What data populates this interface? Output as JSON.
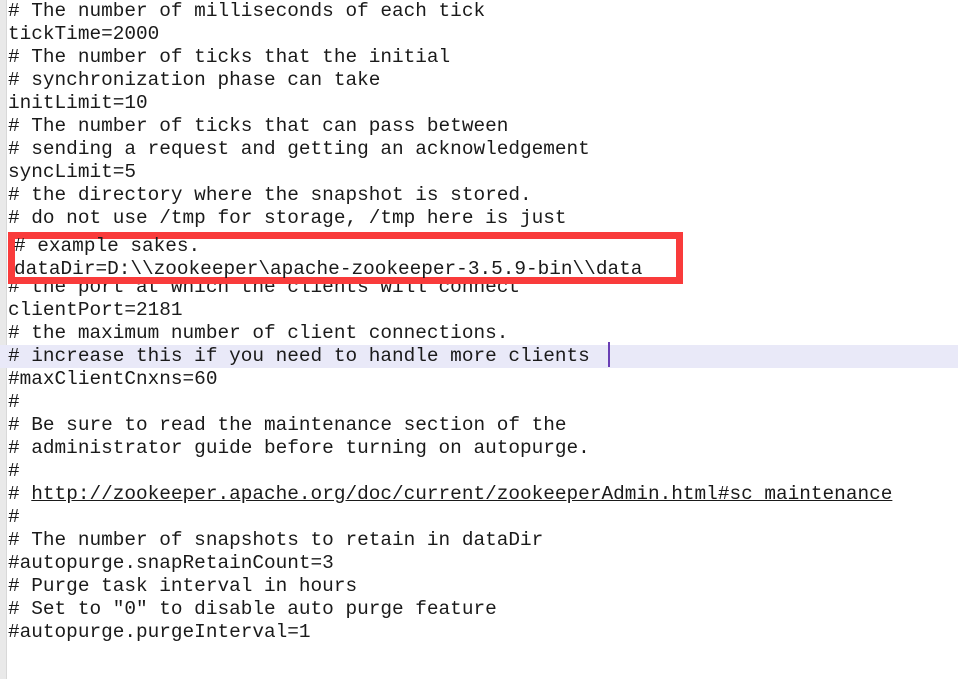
{
  "editor": {
    "kind": "text-editor",
    "filetype": "properties",
    "background_color": "#ffffff",
    "text_color": "#1a1a1a",
    "gutter_color": "#e9e9e9",
    "current_line_highlight_color": "#e9e9f8",
    "caret_color": "#6a3fb5",
    "annotation_color": "#f93b3b",
    "lines": [
      "# The number of milliseconds of each tick",
      "tickTime=2000",
      "# The number of ticks that the initial",
      "# synchronization phase can take",
      "initLimit=10",
      "# The number of ticks that can pass between",
      "# sending a request and getting an acknowledgement",
      "syncLimit=5",
      "# the directory where the snapshot is stored.",
      "# do not use /tmp for storage, /tmp here is just",
      "# example sakes.",
      "dataDir=D:\\\\zookeeper\\apache-zookeeper-3.5.9-bin\\\\data",
      "# the port at which the clients will connect",
      "clientPort=2181",
      "# the maximum number of client connections.",
      "# increase this if you need to handle more clients",
      "#maxClientCnxns=60",
      "#",
      "# Be sure to read the maintenance section of the",
      "# administrator guide before turning on autopurge.",
      "#",
      "#",
      "#",
      "# The number of snapshots to retain in dataDir",
      "#autopurge.snapRetainCount=3",
      "# Purge task interval in hours",
      "# Set to \"0\" to disable auto purge feature",
      "#autopurge.purgeInterval=1"
    ],
    "link_line": {
      "prefix": "# ",
      "url": "http://zookeeper.apache.org/doc/current/zookeeperAdmin.html#sc_maintenance"
    },
    "current_line_index": 15,
    "current_line_text": "# increase this if you need to handle more clients",
    "annotation": {
      "type": "red-rectangle-highlight",
      "highlighted_lines": [
        "# example sakes.",
        "dataDir=D:\\\\zookeeper\\apache-zookeeper-3.5.9-bin\\\\data"
      ]
    }
  }
}
